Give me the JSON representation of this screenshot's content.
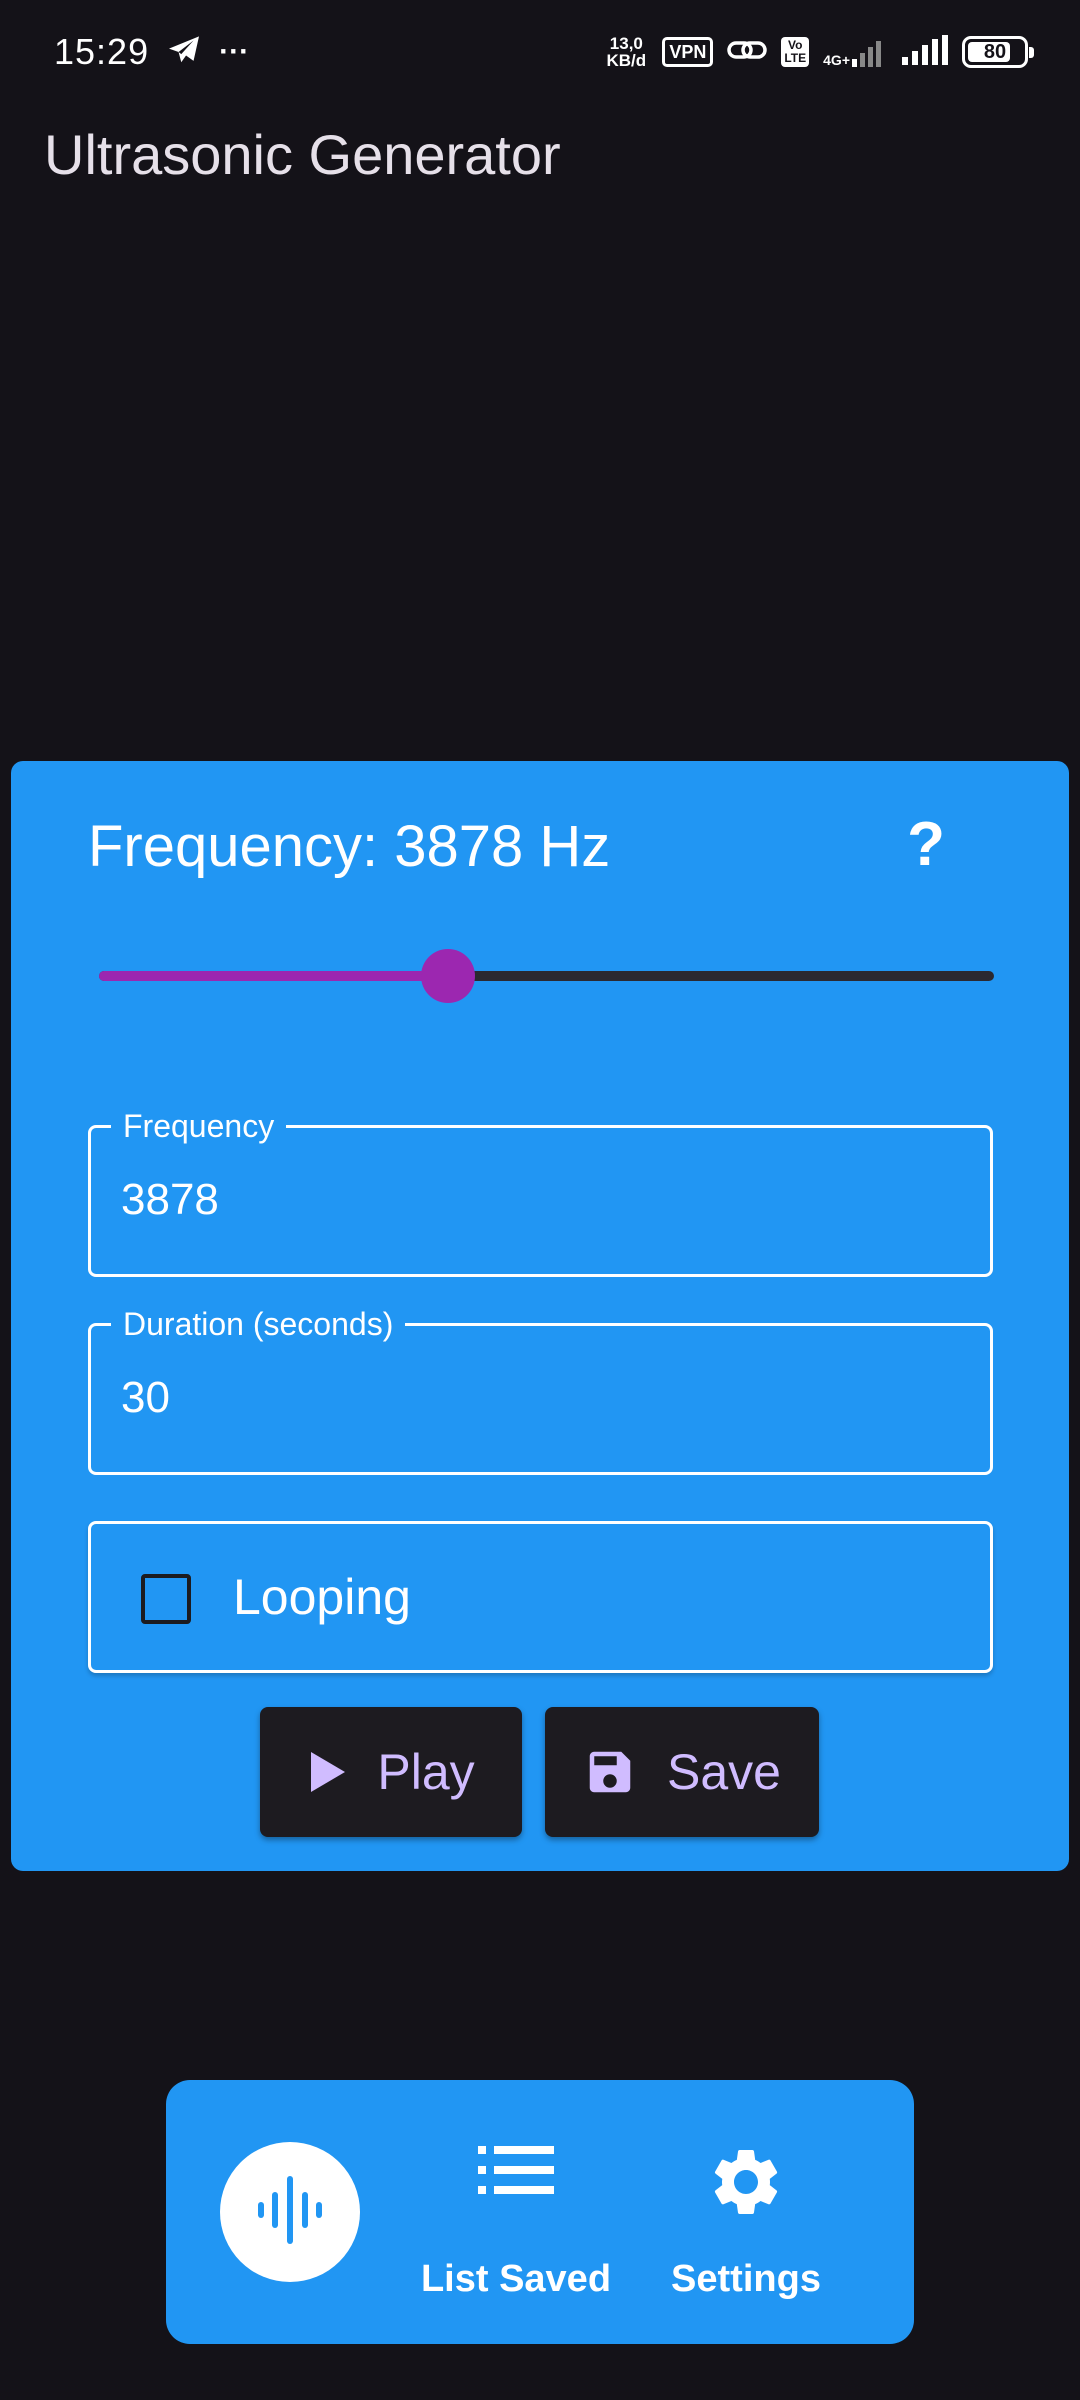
{
  "status_bar": {
    "time": "15:29",
    "more": "···",
    "speed_value": "13,0",
    "speed_unit": "KB/d",
    "vpn": "VPN",
    "volte_top": "Vo",
    "volte_bottom": "LTE",
    "network": "4G+",
    "battery": "80",
    "battery_level_percent": 80,
    "icons": [
      "telegram-icon",
      "link-icon",
      "signal-icon"
    ]
  },
  "app_bar": {
    "title": "Ultrasonic Generator"
  },
  "generator": {
    "heading": "Frequency: 3878 Hz",
    "help_label": "?",
    "slider_fraction": 0.39,
    "colors": {
      "card": "#2196f3",
      "slider_active": "#9c27b0",
      "slider_inactive": "#2b2930",
      "button_bg": "#1d1b20",
      "button_text": "#d0bcff"
    },
    "frequency_field": {
      "label": "Frequency",
      "value": "3878"
    },
    "duration_field": {
      "label": "Duration (seconds)",
      "value": "30"
    },
    "looping": {
      "label": "Looping",
      "checked": false
    },
    "play_button": {
      "label": "Play",
      "icon": "play-icon"
    },
    "save_button": {
      "label": "Save",
      "icon": "floppy-disk-icon"
    }
  },
  "bottom_nav": {
    "items": [
      {
        "icon": "sound-wave-icon",
        "label": "",
        "selected": true
      },
      {
        "icon": "list-icon",
        "label": "List Saved",
        "selected": false
      },
      {
        "icon": "gear-icon",
        "label": "Settings",
        "selected": false
      }
    ]
  }
}
